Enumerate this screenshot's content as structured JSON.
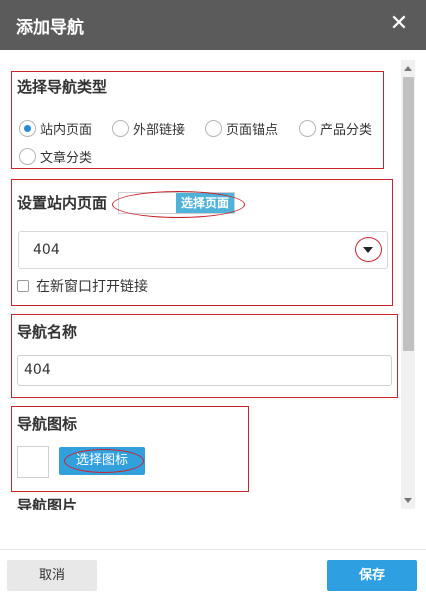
{
  "dialog": {
    "title": "添加导航",
    "close_glyph": "✕"
  },
  "nav_type": {
    "heading": "选择导航类型",
    "options": [
      {
        "label": "站内页面",
        "checked": true
      },
      {
        "label": "外部链接",
        "checked": false
      },
      {
        "label": "页面锚点",
        "checked": false
      },
      {
        "label": "产品分类",
        "checked": false
      },
      {
        "label": "文章分类",
        "checked": false
      }
    ]
  },
  "page_setting": {
    "heading": "设置站内页面",
    "pick_button": "选择页面",
    "selected_page": "404",
    "new_window_label": "在新窗口打开链接",
    "new_window_checked": false
  },
  "nav_name": {
    "heading": "导航名称",
    "value": "404"
  },
  "nav_icon": {
    "heading": "导航图标",
    "pick_button": "选择图标"
  },
  "nav_image": {
    "heading": "导航图片"
  },
  "footer": {
    "cancel_label": "取消",
    "save_label": "保存"
  },
  "colors": {
    "header_bg": "#5b5b5b",
    "accent_blue": "#2e9fe0",
    "highlight_red": "#c9242d"
  }
}
